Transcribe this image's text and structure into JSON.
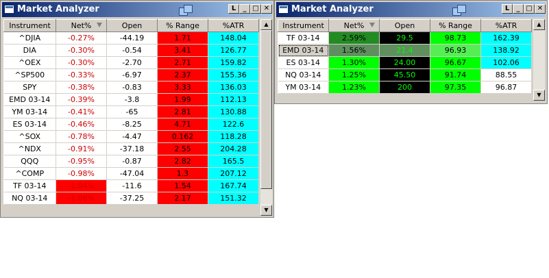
{
  "win1": {
    "title": "Market Analyzer",
    "columns": [
      "Instrument",
      "Net%",
      "Open",
      "% Range",
      "%ATR"
    ],
    "rows": [
      {
        "inst": "^DJIA",
        "net": "-0.27%",
        "open": "-44.19",
        "range": "1.71",
        "atr": "148.04"
      },
      {
        "inst": "DIA",
        "net": "-0.30%",
        "open": "-0.54",
        "range": "3.41",
        "atr": "126.77"
      },
      {
        "inst": "^OEX",
        "net": "-0.30%",
        "open": "-2.70",
        "range": "2.71",
        "atr": "159.82"
      },
      {
        "inst": "^SP500",
        "net": "-0.33%",
        "open": "-6.97",
        "range": "2.37",
        "atr": "155.36"
      },
      {
        "inst": "SPY",
        "net": "-0.38%",
        "open": "-0.83",
        "range": "3.33",
        "atr": "136.03"
      },
      {
        "inst": "EMD 03-14",
        "net": "-0.39%",
        "open": "-3.8",
        "range": "1.99",
        "atr": "112.13"
      },
      {
        "inst": "YM 03-14",
        "net": "-0.41%",
        "open": "-65",
        "range": "2.81",
        "atr": "130.88"
      },
      {
        "inst": "ES 03-14",
        "net": "-0.46%",
        "open": "-8.25",
        "range": "4.71",
        "atr": "122.6"
      },
      {
        "inst": "^SOX",
        "net": "-0.78%",
        "open": "-4.47",
        "range": "0.162",
        "atr": "118.28"
      },
      {
        "inst": "^NDX",
        "net": "-0.91%",
        "open": "-37.18",
        "range": "2.55",
        "atr": "204.28"
      },
      {
        "inst": "QQQ",
        "net": "-0.95%",
        "open": "-0.87",
        "range": "2.82",
        "atr": "165.5"
      },
      {
        "inst": "^COMP",
        "net": "-0.98%",
        "open": "-47.04",
        "range": "1.3",
        "atr": "207.12"
      },
      {
        "inst": "TF 03-14",
        "net": "-1.04%",
        "open": "-11.6",
        "range": "1.54",
        "atr": "167.74"
      },
      {
        "inst": "NQ 03-14",
        "net": "-1.06%",
        "open": "-37.25",
        "range": "2.17",
        "atr": "151.32"
      }
    ]
  },
  "win2": {
    "title": "Market Analyzer",
    "columns": [
      "Instrument",
      "Net%",
      "Open",
      "% Range",
      "%ATR"
    ],
    "rows": [
      {
        "inst": "TF 03-14",
        "net": "2.59%",
        "open": "29.5",
        "range": "98.73",
        "atr": "162.39"
      },
      {
        "inst": "EMD 03-14",
        "net": "1.56%",
        "open": "21.4",
        "range": "96.93",
        "atr": "138.92"
      },
      {
        "inst": "ES 03-14",
        "net": "1.30%",
        "open": "24.00",
        "range": "96.67",
        "atr": "102.06"
      },
      {
        "inst": "NQ 03-14",
        "net": "1.25%",
        "open": "45.50",
        "range": "91.74",
        "atr": "88.55"
      },
      {
        "inst": "YM 03-14",
        "net": "1.23%",
        "open": "200",
        "range": "97.35",
        "atr": "96.87"
      }
    ]
  },
  "buttons": {
    "min": "_",
    "max": "□",
    "close": "✕",
    "link": "L"
  },
  "colors": {
    "neg_text": "#cc0000",
    "red_cell": "#ff0000",
    "cyan_cell": "#00ffff",
    "green_bright": "#00ff00",
    "green_dark": "#228b22",
    "green_mid": "#55ee55",
    "green_gray": "#5f8f5f",
    "black": "#000000"
  }
}
